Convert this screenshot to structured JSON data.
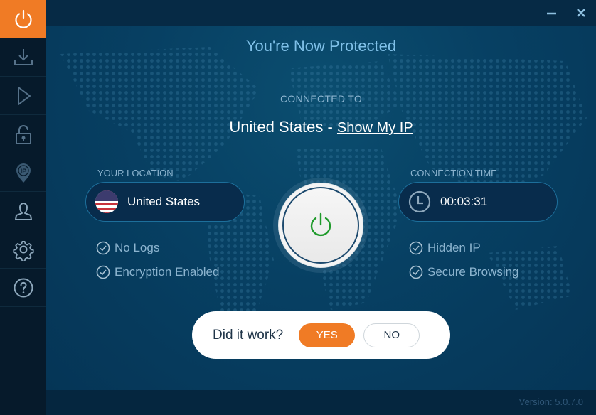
{
  "window": {
    "minimize_icon": "minimize-icon",
    "close_icon": "close-icon"
  },
  "sidebar": {
    "items": [
      {
        "id": "power",
        "icon": "power-icon",
        "active": true
      },
      {
        "id": "download",
        "icon": "download-icon",
        "active": false
      },
      {
        "id": "play",
        "icon": "play-icon",
        "active": false
      },
      {
        "id": "lock",
        "icon": "lock-icon",
        "active": false
      },
      {
        "id": "ip",
        "icon": "ip-location-icon",
        "active": false
      },
      {
        "id": "account",
        "icon": "user-icon",
        "active": false
      },
      {
        "id": "settings",
        "icon": "gear-icon",
        "active": false
      },
      {
        "id": "help",
        "icon": "help-icon",
        "active": false
      }
    ]
  },
  "main": {
    "title": "You're Now Protected",
    "connected_label": "CONNECTED TO",
    "connected_country": "United States",
    "separator": " - ",
    "show_ip_link": "Show My IP",
    "your_location": {
      "label": "YOUR LOCATION",
      "country": "United States",
      "flag_icon": "us-flag-icon"
    },
    "connection_time": {
      "label": "CONNECTION TIME",
      "value": "00:03:31",
      "icon": "clock-icon"
    },
    "left_features": [
      "No Logs",
      "Encryption Enabled"
    ],
    "right_features": [
      "Hidden IP",
      "Secure Browsing"
    ],
    "power_button_state": "connected",
    "colors": {
      "accent": "#f07b25",
      "power_green": "#1e9a2a",
      "title": "#7fc0e8"
    }
  },
  "feedback": {
    "question": "Did it work?",
    "yes_label": "YES",
    "no_label": "NO"
  },
  "footer": {
    "version_label": "Version:",
    "version_value": "5.0.7.0"
  }
}
